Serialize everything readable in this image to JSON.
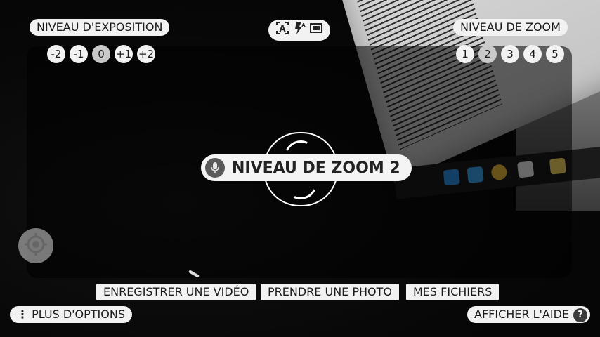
{
  "exposure": {
    "label": "NIVEAU D'EXPOSITION",
    "levels": [
      "-2",
      "-1",
      "0",
      "+1",
      "+2"
    ],
    "selected": "0"
  },
  "zoom": {
    "label": "NIVEAU DE ZOOM",
    "levels": [
      "1",
      "2",
      "3",
      "4",
      "5"
    ],
    "selected": "2"
  },
  "top_icons": [
    "auto-text-icon",
    "auto-flash-icon",
    "aspect-ratio-icon"
  ],
  "toast": {
    "text": "NIVEAU DE ZOOM 2",
    "icon": "microphone-icon"
  },
  "bottom_actions": {
    "record_video": "ENREGISTRER UNE VIDÉO",
    "take_photo": "PRENDRE UNE PHOTO",
    "my_files": "MES FICHIERS"
  },
  "more_options": "PLUS D'OPTIONS",
  "show_help": "AFFICHER L'AIDE",
  "help_icon_text": "?",
  "colors": {
    "pill_bg": "#f2f2f2",
    "selected_bg": "#c9c9c9",
    "mic_bg": "#5a5a5a"
  }
}
